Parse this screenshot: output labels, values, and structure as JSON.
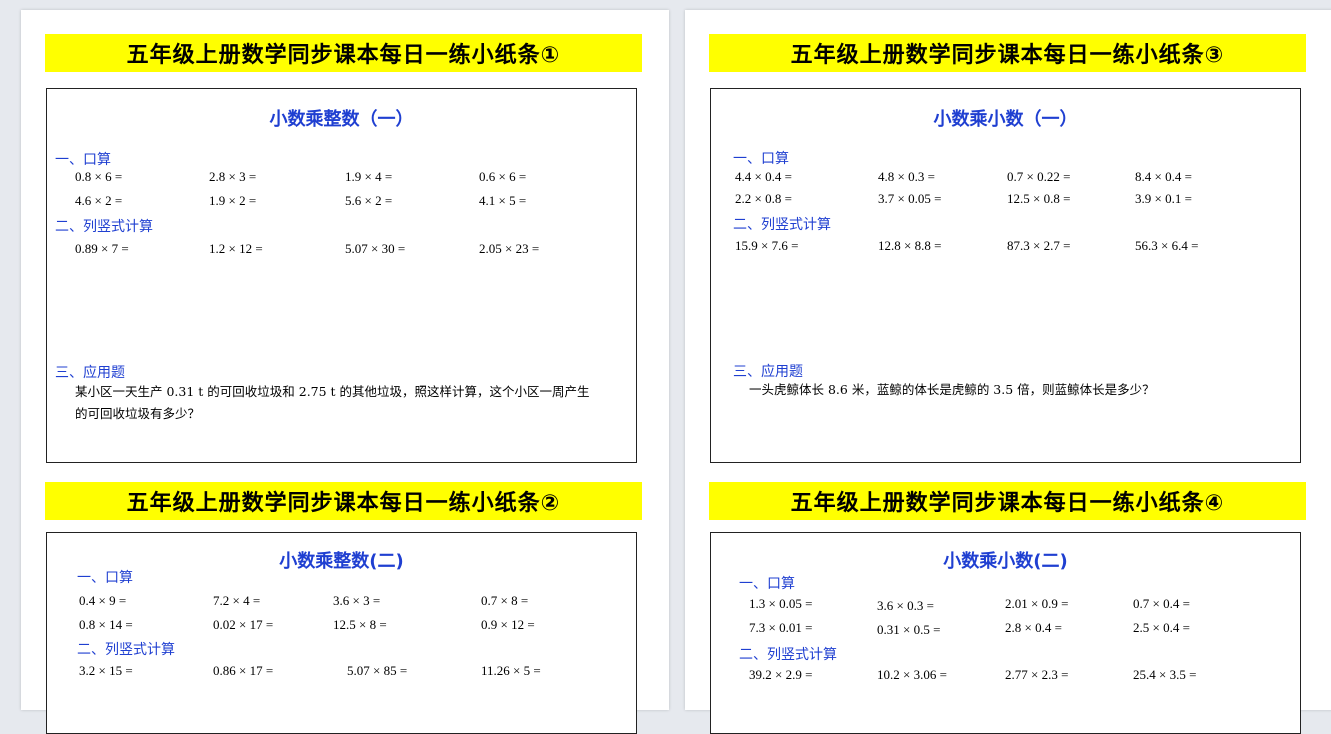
{
  "cards": {
    "c1": {
      "banner": "五年级上册数学同步课本每日一练小纸条①",
      "title": "小数乘整数（一）",
      "sec1": "一、口算",
      "oral": [
        "0.8 × 6 =",
        "2.8 × 3 =",
        "1.9 × 4 =",
        "0.6 × 6 =",
        "4.6 × 2 =",
        "1.9 × 2 =",
        "5.6 × 2 =",
        "4.1 × 5 ="
      ],
      "sec2": "二、列竖式计算",
      "vertical": [
        "0.89 × 7 =",
        "1.2 × 12 =",
        "5.07 × 30 =",
        "2.05 × 23 ="
      ],
      "sec3": "三、应用题",
      "word1": "某小区一天生产 0.31 t 的可回收垃圾和 2.75 t 的其他垃圾，照这样计算，这个小区一周产生",
      "word2": "的可回收垃圾有多少？"
    },
    "c2": {
      "banner": "五年级上册数学同步课本每日一练小纸条②",
      "title": "小数乘整数(二)",
      "sec1": "一、口算",
      "oral": [
        "0.4 × 9 =",
        "7.2 × 4 =",
        "3.6 × 3 =",
        "0.7 × 8 =",
        "0.8 × 14 =",
        "0.02 × 17 =",
        "12.5 × 8 =",
        "0.9 × 12 ="
      ],
      "sec2": "二、列竖式计算",
      "vertical": [
        "3.2 × 15 =",
        "0.86 × 17 =",
        "5.07 × 85 =",
        "11.26 × 5 ="
      ]
    },
    "c3": {
      "banner": "五年级上册数学同步课本每日一练小纸条③",
      "title": "小数乘小数（一）",
      "sec1": "一、口算",
      "oral": [
        "4.4 × 0.4 =",
        "4.8 × 0.3 =",
        "0.7 × 0.22 =",
        "8.4 × 0.4 =",
        "2.2 × 0.8 =",
        "3.7 × 0.05 =",
        "12.5 × 0.8 =",
        "3.9 × 0.1 ="
      ],
      "sec2": "二、列竖式计算",
      "vertical": [
        "15.9 × 7.6 =",
        "12.8 × 8.8 =",
        "87.3 × 2.7 =",
        "56.3 × 6.4 ="
      ],
      "sec3": "三、应用题",
      "word1": "一头虎鲸体长 8.6 米，蓝鲸的体长是虎鲸的 3.5 倍，则蓝鲸体长是多少？"
    },
    "c4": {
      "banner": "五年级上册数学同步课本每日一练小纸条④",
      "title": "小数乘小数(二)",
      "sec1": "一、口算",
      "oral": [
        "1.3 × 0.05 =",
        "3.6 × 0.3 =",
        "2.01 × 0.9 =",
        "0.7 × 0.4 =",
        "7.3 × 0.01 =",
        "0.31 × 0.5 =",
        "2.8 × 0.4 =",
        "2.5 × 0.4 ="
      ],
      "sec2": "二、列竖式计算",
      "vertical": [
        "39.2 × 2.9 =",
        "10.2 × 3.06 =",
        "2.77 × 2.3 =",
        "25.4 × 3.5 ="
      ]
    }
  }
}
